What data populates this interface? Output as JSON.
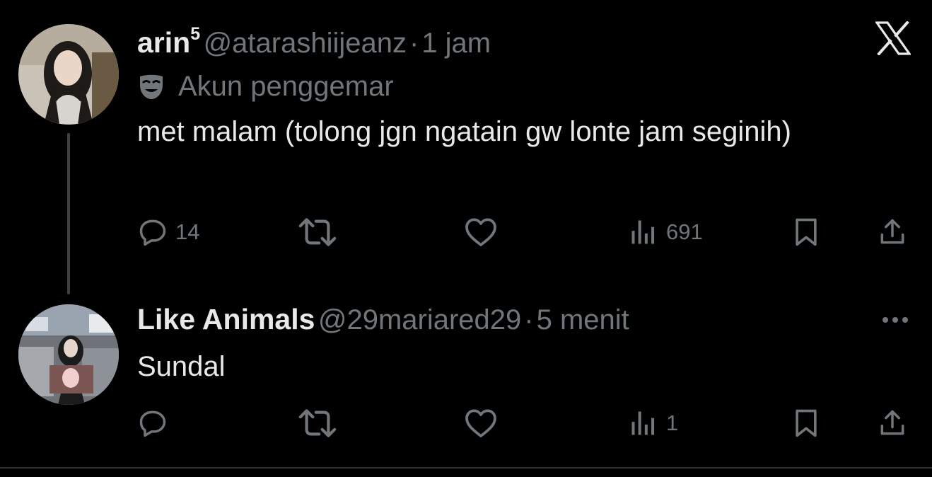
{
  "tweet1": {
    "display_name": "arin",
    "name_superscript": "5",
    "handle": "@atarashiijeanz",
    "separator": "·",
    "time": "1 jam",
    "label": "Akun penggemar",
    "text": "met malam (tolong jgn ngatain gw lonte jam seginih)",
    "replies": "14",
    "views": "691"
  },
  "tweet2": {
    "display_name": "Like Animals",
    "handle": "@29mariared29",
    "separator": "·",
    "time": "5 menit",
    "text": "Sundal",
    "views": "1"
  },
  "icons": {
    "logo": "x-logo-icon",
    "label": "theater-mask-icon",
    "reply": "reply-bubble-icon",
    "repost": "repost-icon",
    "like": "heart-icon",
    "views": "bar-chart-icon",
    "bookmark": "bookmark-icon",
    "share": "share-upload-icon",
    "more": "more-dots-icon"
  },
  "colors": {
    "background": "#000000",
    "text": "#e7e9ea",
    "muted": "#71767b",
    "thread_line": "#3e4144"
  }
}
